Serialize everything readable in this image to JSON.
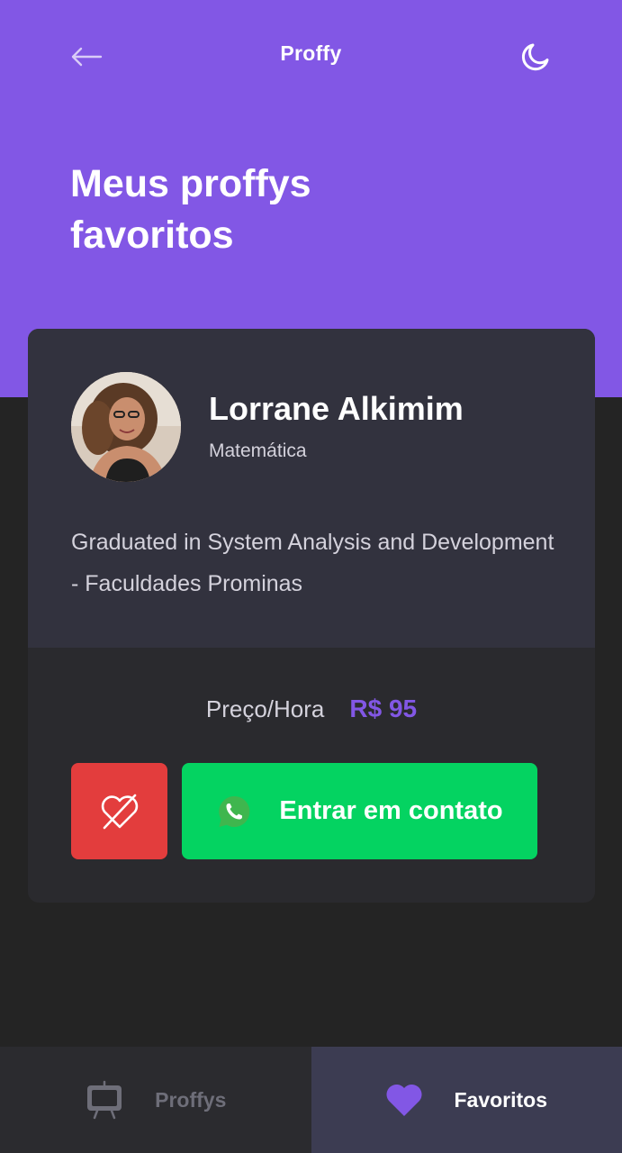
{
  "app": {
    "logo": "Proffy"
  },
  "header": {
    "title": "Meus proffys favoritos"
  },
  "teacher": {
    "name": "Lorrane Alkimim",
    "subject": "Matemática",
    "bio": "Graduated in System Analysis and Development - Faculdades Prominas",
    "price_label": "Preço/Hora",
    "price_value": "R$ 95",
    "contact_label": "Entrar em contato"
  },
  "tabs": [
    {
      "label": "Proffys",
      "active": false
    },
    {
      "label": "Favoritos",
      "active": true
    }
  ],
  "colors": {
    "primary": "#8257E5",
    "background": "#242424",
    "card_top": "#32323E",
    "danger": "#E33D3D",
    "success": "#04D361",
    "tab_active_bg": "#3C3C52"
  },
  "icons": {
    "back": "arrow-left-icon",
    "theme": "moon-icon",
    "unfavorite": "heart-off-icon",
    "contact": "whatsapp-icon",
    "tab_proffys": "tv-easel-icon",
    "tab_favoritos": "heart-icon"
  }
}
